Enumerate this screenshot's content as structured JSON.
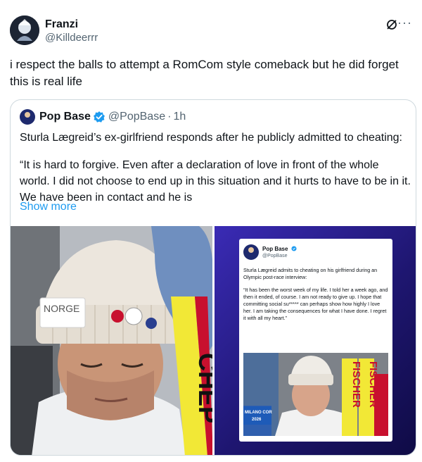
{
  "author": {
    "name": "Franzi",
    "handle": "@Killdeerrr"
  },
  "tweet": {
    "text": "i respect the balls to attempt a RomCom style comeback but he did forget this is real life"
  },
  "quote": {
    "name": "Pop Base",
    "handle": "@PopBase",
    "separator": "·",
    "time": "1h",
    "text_line1": "Sturla Lægreid’s ex-girlfriend responds after he publicly admitted to cheating:",
    "text_quote": "“It is hard to forgive. Even after a declaration of love in front of the whole world. I did not choose to end up in this situation and it hurts to have to be in it. We have been in contact and he is",
    "show_more": "Show more"
  },
  "media": {
    "left_photo": {
      "hat_text": "NORGE",
      "ski_text": "CHEP"
    },
    "right_card": {
      "name": "Pop Base",
      "handle": "@PopBase",
      "text_line1": "Sturla Lægreid admits to cheating on his girlfriend during an Olympic post-race interview:",
      "text_quote": "“It has been the worst week of my life. I told her a week ago, and then it ended, of course. I am not ready to give up. I hope that committing social su***** can perhaps show how highly I love her. I am taking the consequences for what I have done. I regret it with all my heart.”",
      "ski_text_1": "FISCHER",
      "ski_text_2": "FISCHER",
      "milano_text": "MILANO COR",
      "year_text": "2026"
    }
  },
  "colors": {
    "text": "#0f1419",
    "secondary": "#536471",
    "link": "#1d9bf0",
    "verified": "#1d9bf0",
    "border": "#cfd9de"
  }
}
